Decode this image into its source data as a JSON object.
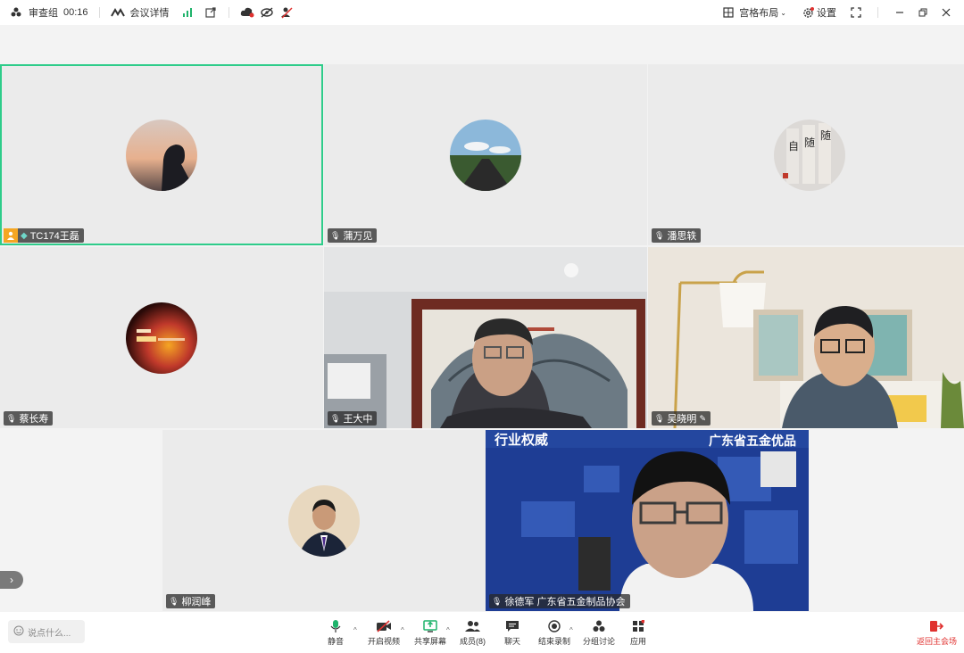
{
  "topbar": {
    "meeting_name": "审查组",
    "timer": "00:16",
    "details_label": "会议详情",
    "layout_label": "宫格布局",
    "settings_label": "设置"
  },
  "tiles": [
    {
      "name": "TC174王磊",
      "active": true,
      "host": true
    },
    {
      "name": "蒲万见"
    },
    {
      "name": "潘思轶"
    },
    {
      "name": "蔡长寿"
    },
    {
      "name": "王大中"
    },
    {
      "name": "吴晓明"
    },
    {
      "name": "柳润峰"
    },
    {
      "name": "徐德军 广东省五金制品协会"
    }
  ],
  "poster_text": {
    "top_left": "行业权威",
    "top_right": "广东省五金优品"
  },
  "bottombar": {
    "chat_placeholder": "说点什么...",
    "mute": "静音",
    "video": "开启视频",
    "share": "共享屏幕",
    "members": "成员(8)",
    "chat": "聊天",
    "record": "结束录制",
    "breakout": "分组讨论",
    "apps": "应用",
    "leave": "返回主会场"
  },
  "colors": {
    "active_border": "#2ecc8a",
    "leave_red": "#e0312f",
    "host_orange": "#f5a623",
    "mic_green": "#1fb36b"
  }
}
